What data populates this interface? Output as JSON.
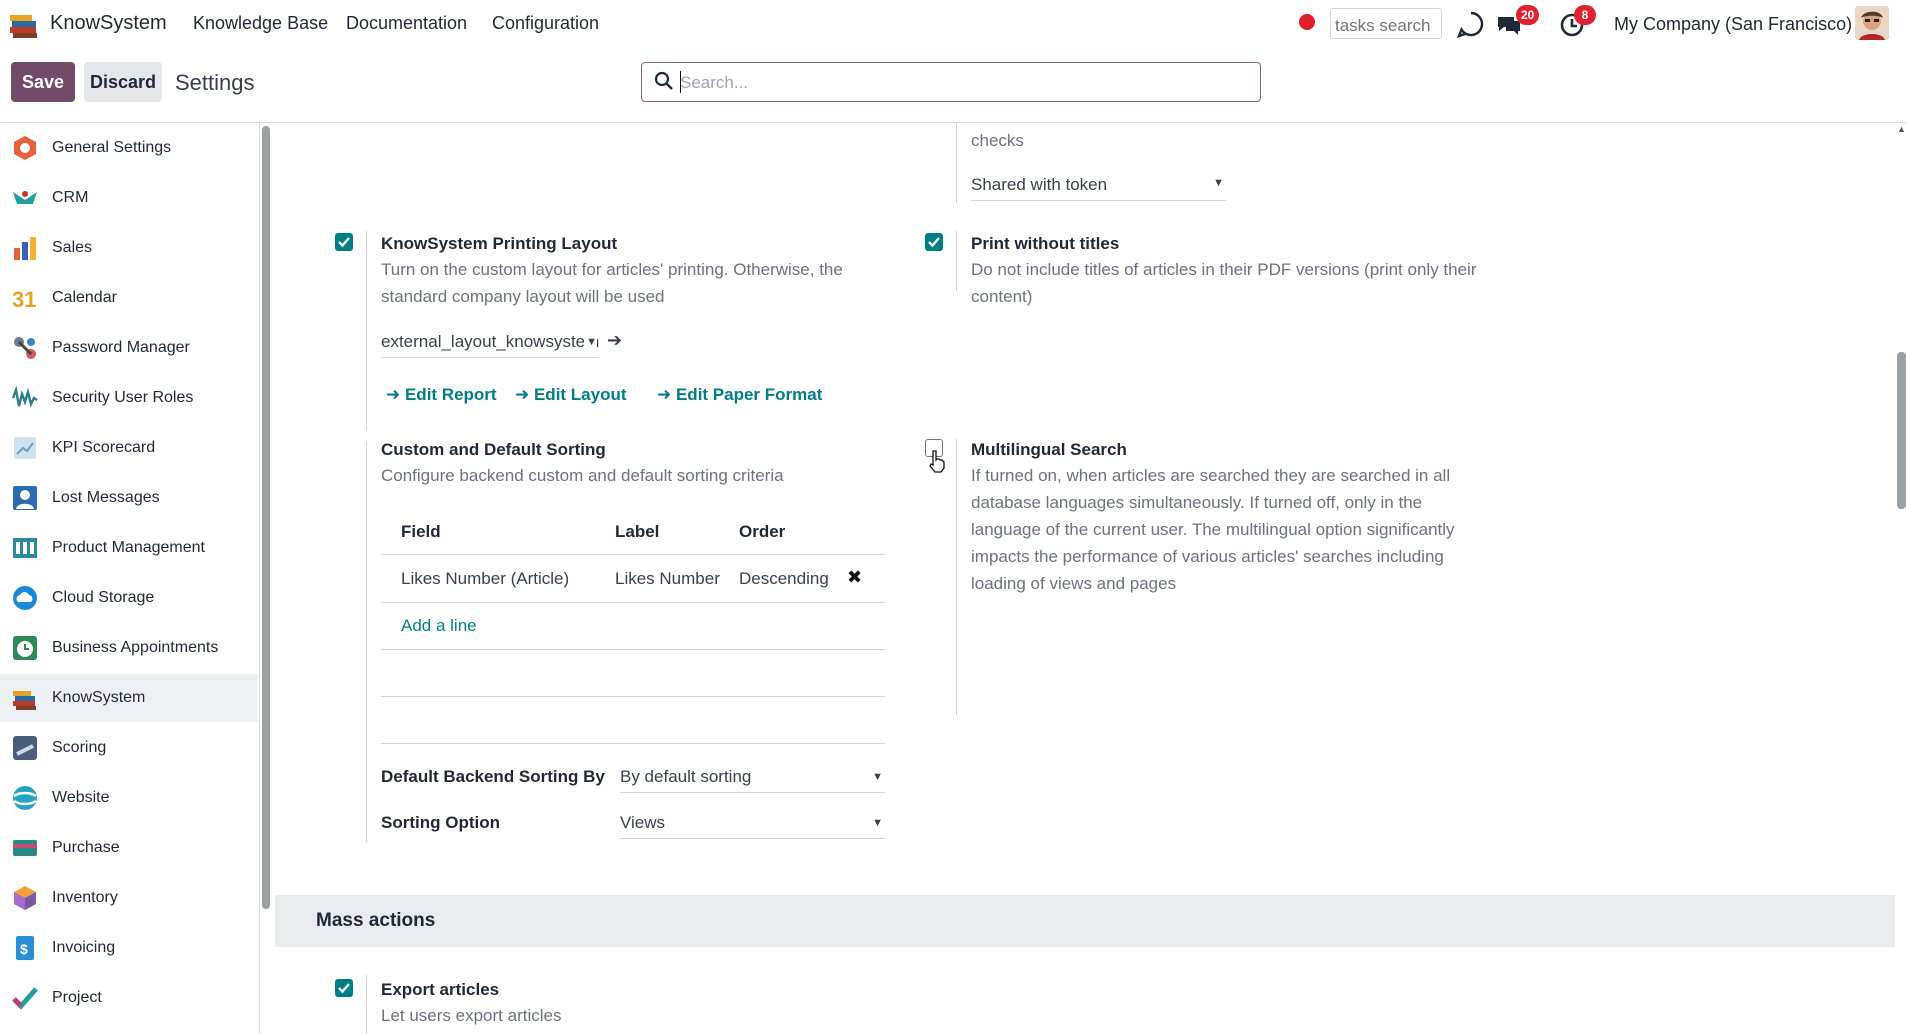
{
  "app": {
    "title": "KnowSystem",
    "menu": [
      "Knowledge Base",
      "Documentation",
      "Configuration"
    ],
    "tasks_search_placeholder": "tasks search",
    "messages_badge": "20",
    "activities_badge": "8",
    "company": "My Company (San Francisco)"
  },
  "control": {
    "save_label": "Save",
    "discard_label": "Discard",
    "breadcrumb": "Settings",
    "search_placeholder": "Search..."
  },
  "sidebar": {
    "items": [
      {
        "label": "General Settings",
        "icon": "general-settings-icon"
      },
      {
        "label": "CRM",
        "icon": "crm-icon"
      },
      {
        "label": "Sales",
        "icon": "sales-icon"
      },
      {
        "label": "Calendar",
        "icon": "calendar-icon"
      },
      {
        "label": "Password Manager",
        "icon": "password-manager-icon"
      },
      {
        "label": "Security User Roles",
        "icon": "security-roles-icon"
      },
      {
        "label": "KPI Scorecard",
        "icon": "kpi-icon"
      },
      {
        "label": "Lost Messages",
        "icon": "lost-messages-icon"
      },
      {
        "label": "Product Management",
        "icon": "product-management-icon"
      },
      {
        "label": "Cloud Storage",
        "icon": "cloud-storage-icon"
      },
      {
        "label": "Business Appointments",
        "icon": "appointments-icon"
      },
      {
        "label": "KnowSystem",
        "icon": "knowsystem-icon"
      },
      {
        "label": "Scoring",
        "icon": "scoring-icon"
      },
      {
        "label": "Website",
        "icon": "website-icon"
      },
      {
        "label": "Purchase",
        "icon": "purchase-icon"
      },
      {
        "label": "Inventory",
        "icon": "inventory-icon"
      },
      {
        "label": "Invoicing",
        "icon": "invoicing-icon"
      },
      {
        "label": "Project",
        "icon": "project-icon"
      }
    ],
    "active": "KnowSystem"
  },
  "settings": {
    "partial_desc_tail": "checks",
    "share_select_value": "Shared with token",
    "printing_layout": {
      "title": "KnowSystem Printing Layout",
      "desc": "Turn on the custom layout for articles' printing. Otherwise, the standard company layout will be used",
      "select_value": "external_layout_knowsystem",
      "links": [
        "Edit Report",
        "Edit Layout",
        "Edit Paper Format"
      ],
      "checked": true
    },
    "print_without_titles": {
      "title": "Print without titles",
      "desc": "Do not include titles of articles in their PDF versions (print only their content)",
      "checked": true
    },
    "sorting": {
      "title": "Custom and Default Sorting",
      "desc": "Configure backend custom and default sorting criteria",
      "columns": [
        "Field",
        "Label",
        "Order"
      ],
      "rows": [
        [
          "Likes Number (Article)",
          "Likes Number",
          "Descending"
        ]
      ],
      "add_line": "Add a line",
      "default_sort_label": "Default Backend Sorting By",
      "default_sort_value": "By default sorting",
      "sort_option_label": "Sorting Option",
      "sort_option_value": "Views"
    },
    "multilingual": {
      "title": "Multilingual Search",
      "desc": "If turned on, when articles are searched they are searched in all database languages simultaneously. If turned off, only in the language of the current user. The multilingual option significantly impacts the performance of various articles' searches including loading of views and pages",
      "checked": false
    },
    "mass_actions": {
      "header": "Mass actions",
      "export_title": "Export articles",
      "export_desc": "Let users export articles",
      "export_checked": true
    }
  },
  "colors": {
    "brand": "#714b67",
    "accent": "#017e84",
    "badge": "#e0242f"
  }
}
